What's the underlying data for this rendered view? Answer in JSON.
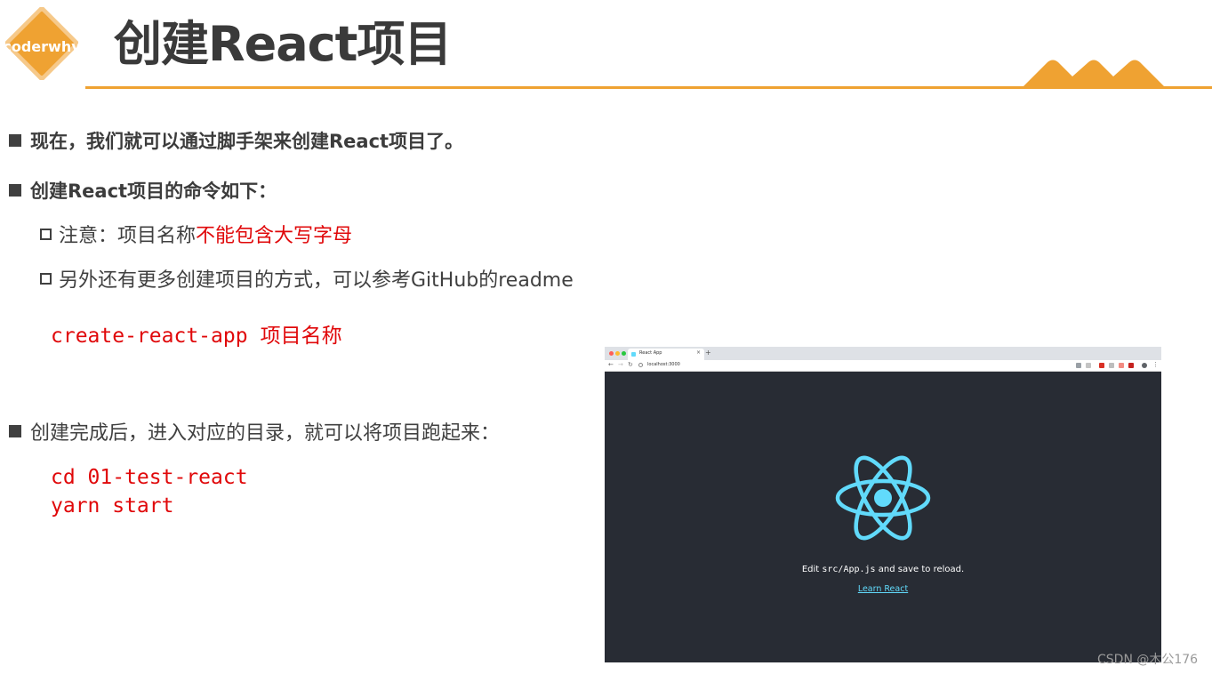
{
  "header": {
    "logo_text": "coderwhy",
    "title": "创建React项目"
  },
  "bullets": [
    {
      "text": "现在，我们就可以通过脚手架来创建React项目了。"
    },
    {
      "text": "创建React项目的命令如下："
    }
  ],
  "sub_bullets": [
    {
      "prefix": "注意：项目名称",
      "highlight": "不能包含大写字母"
    },
    {
      "text": "另外还有更多创建项目的方式，可以参考GitHub的readme"
    }
  ],
  "code_create": {
    "command": "create-react-app",
    "arg": "项目名称"
  },
  "bullet3": {
    "text": "创建完成后，进入对应的目录，就可以将项目跑起来："
  },
  "code_run": [
    "cd 01-test-react",
    "yarn start"
  ],
  "browser": {
    "tab_title": "React App",
    "tab_close": "×",
    "new_tab": "+",
    "url": "localhost:3000",
    "edit_prefix": "Edit ",
    "edit_code": "src/App.js",
    "edit_suffix": " and save to reload.",
    "link": "Learn React"
  },
  "colors": {
    "accent": "#efa232",
    "code_red": "#e0080a",
    "react_cyan": "#61dafb",
    "browser_bg": "#282c34"
  },
  "watermark": "CSDN @木公176"
}
